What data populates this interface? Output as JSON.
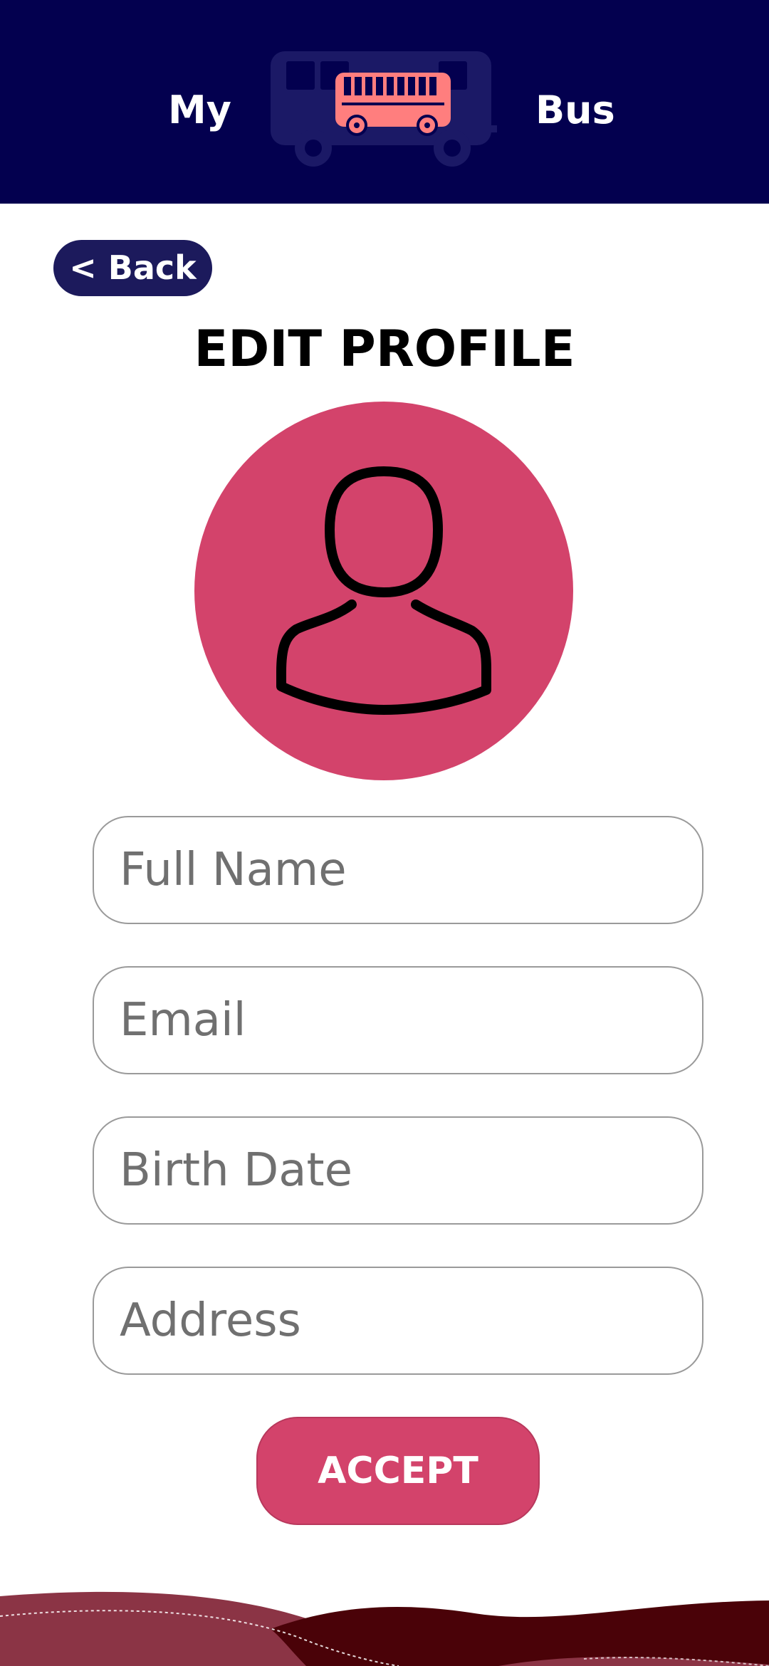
{
  "header": {
    "left_word": "My",
    "right_word": "Bus",
    "logo_icon": "bus-icon",
    "background": "#03004f",
    "logo_color": "#ff7e7e"
  },
  "back_button": {
    "label": "< Back"
  },
  "page": {
    "title": "EDIT PROFILE"
  },
  "avatar": {
    "icon": "user-icon",
    "color": "#d3436b"
  },
  "form": {
    "full_name": {
      "placeholder": "Full Name",
      "value": ""
    },
    "email": {
      "placeholder": "Email",
      "value": ""
    },
    "birth_date": {
      "placeholder": "Birth Date",
      "value": ""
    },
    "address": {
      "placeholder": "Address",
      "value": ""
    }
  },
  "accept_button": {
    "label": "ACCEPT",
    "color": "#d3436b"
  },
  "footer": {
    "wave_colors": [
      "#8b3445",
      "#4a0208"
    ]
  }
}
